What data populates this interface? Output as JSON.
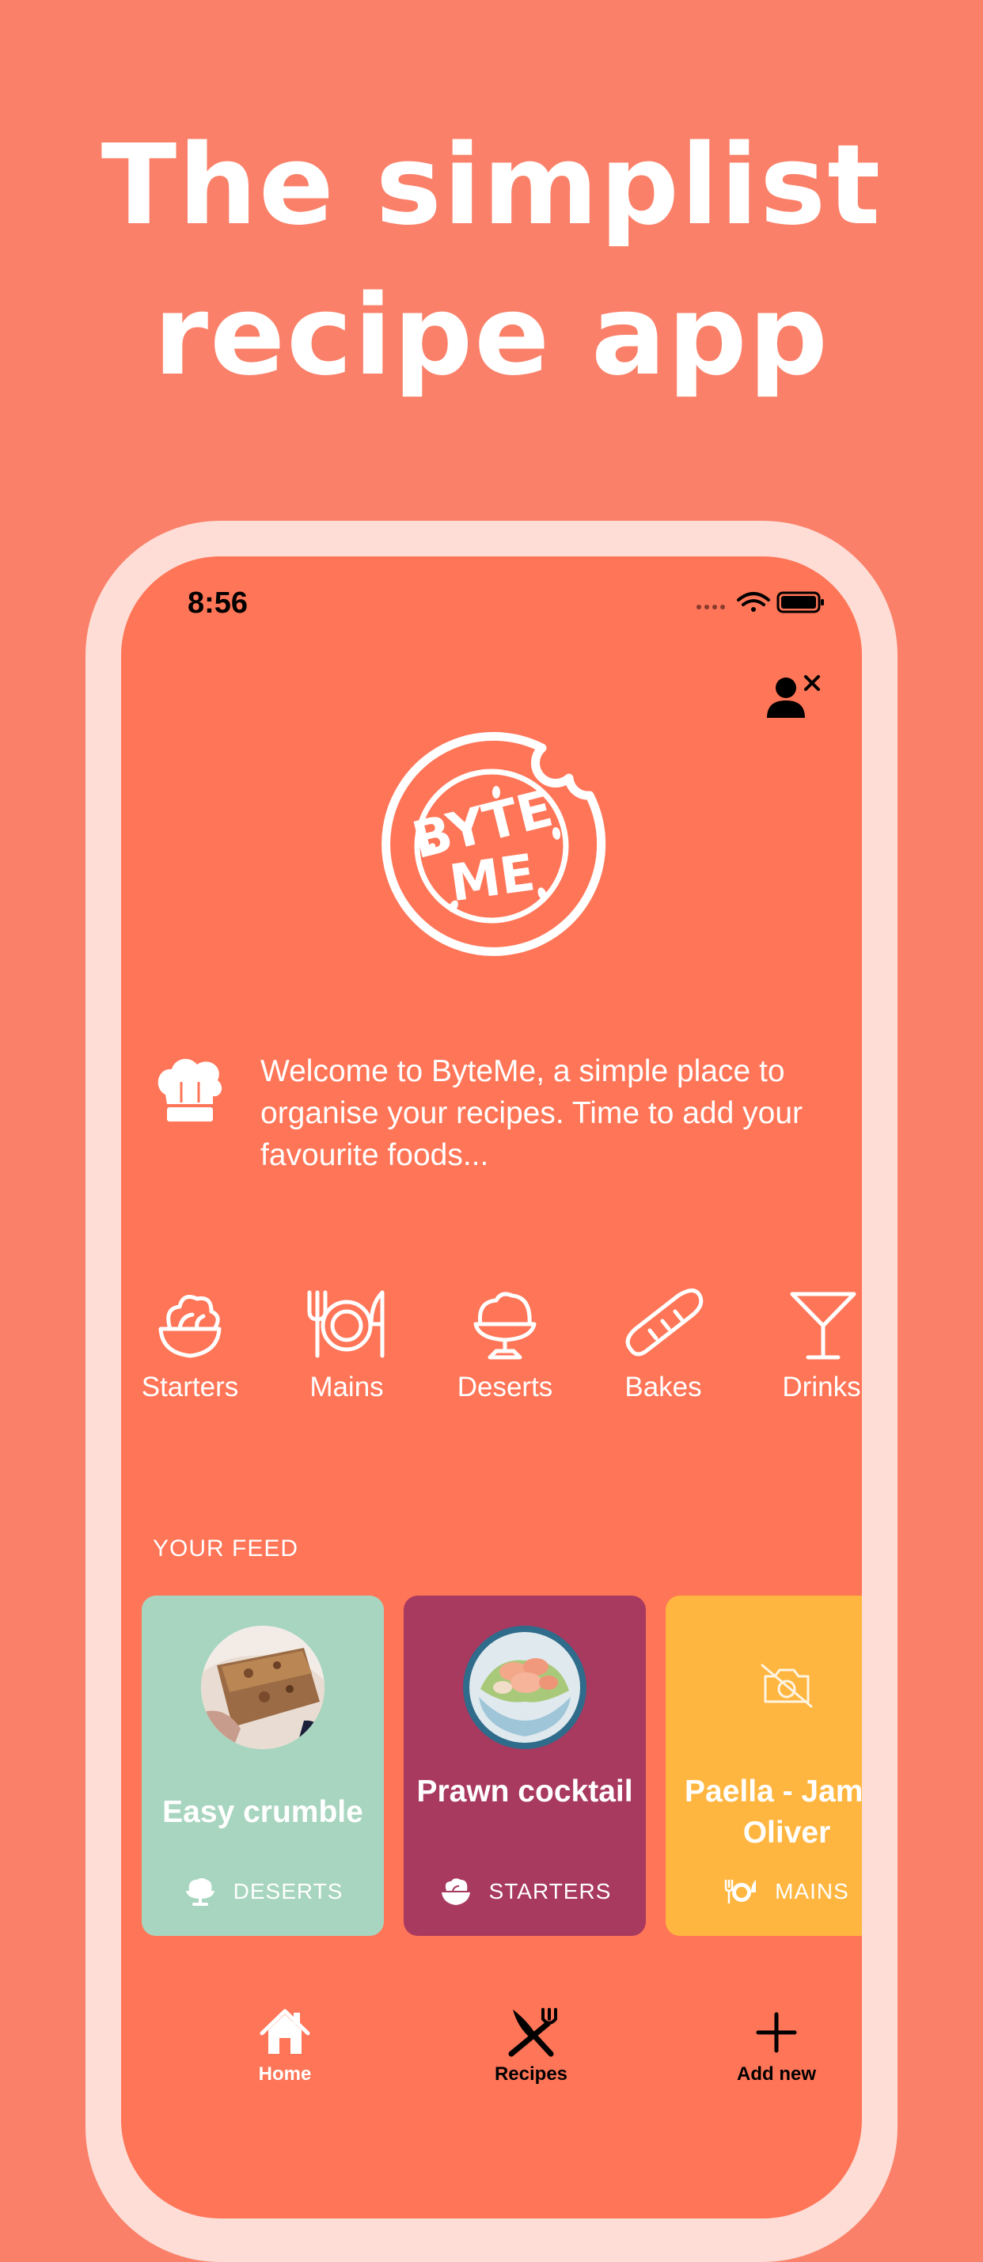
{
  "headline": {
    "line1": "The simplist",
    "line2": "recipe app"
  },
  "status_bar": {
    "time": "8:56"
  },
  "header": {
    "account_icon": "person-remove-icon"
  },
  "logo": {
    "text_top": "BYTE",
    "text_bottom": "ME"
  },
  "welcome": {
    "icon": "chef-hat-icon",
    "text": "Welcome to ByteMe, a simple place to organise your recipes. Time to add your favourite foods..."
  },
  "categories": [
    {
      "label": "Starters",
      "icon": "salad-bowl-icon"
    },
    {
      "label": "Mains",
      "icon": "plate-cutlery-icon"
    },
    {
      "label": "Deserts",
      "icon": "ice-cream-icon"
    },
    {
      "label": "Bakes",
      "icon": "baguette-icon"
    },
    {
      "label": "Drinks",
      "icon": "cocktail-icon"
    }
  ],
  "feed": {
    "title": "YOUR FEED",
    "cards": [
      {
        "name": "Easy crumble",
        "category": "DESERTS",
        "color": "#A8D5BF"
      },
      {
        "name": "Prawn cocktail",
        "category": "STARTERS",
        "color": "#A8395F"
      },
      {
        "name": "Paella - Jamie Oliver",
        "category": "MAINS",
        "color": "#FFB640"
      }
    ]
  },
  "tabbar": {
    "items": [
      {
        "label": "Home",
        "icon": "home-icon",
        "color": "#FFFFFF"
      },
      {
        "label": "Recipes",
        "icon": "fork-knife-icon",
        "color": "#000000"
      },
      {
        "label": "Add new",
        "icon": "plus-icon",
        "color": "#000000"
      }
    ]
  },
  "colors": {
    "background": "#FA8069",
    "screen": "#FF7557",
    "phone_frame": "#FEDDD6"
  }
}
